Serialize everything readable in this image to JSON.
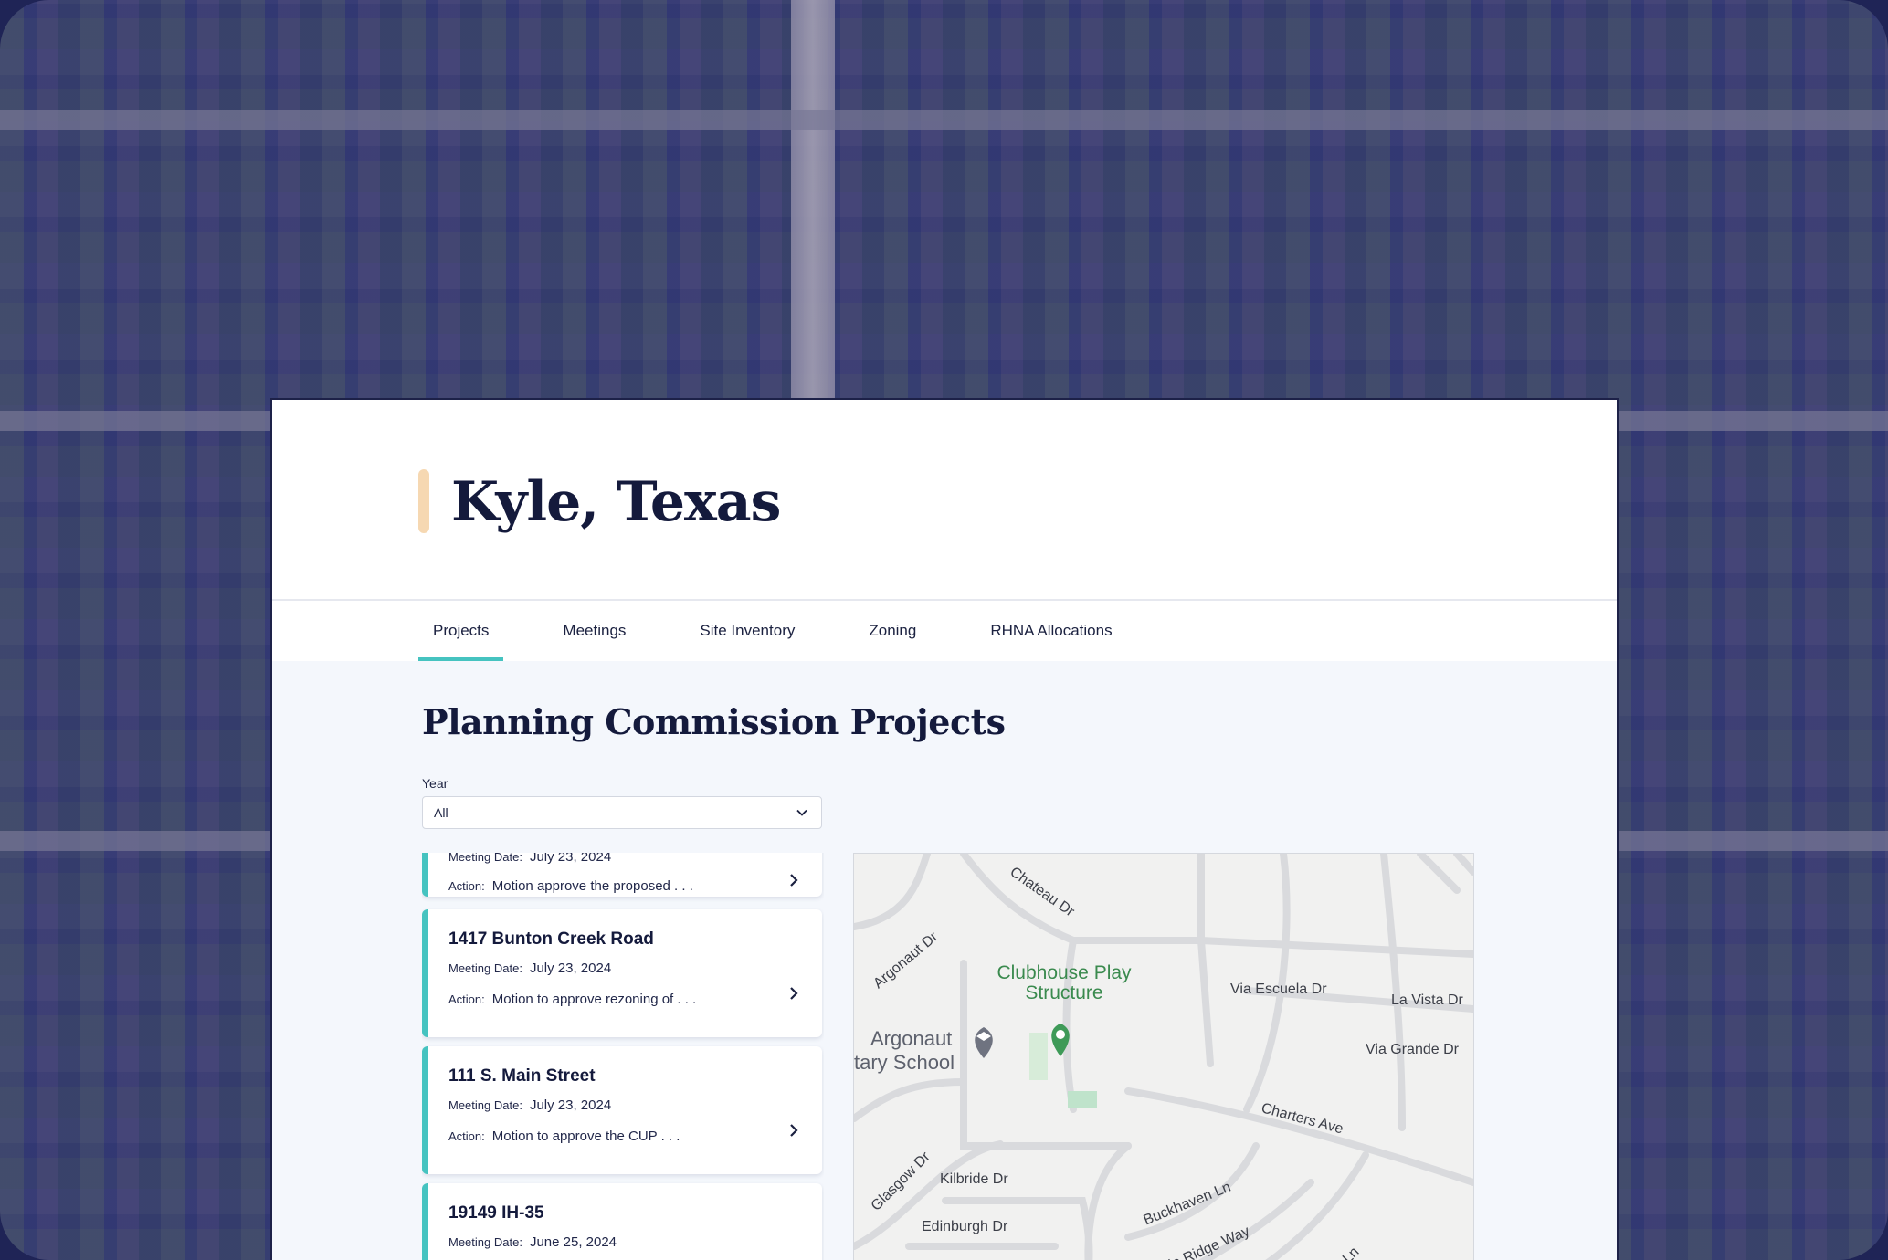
{
  "app": {
    "city_title": "Kyle, Texas",
    "tabs": [
      {
        "label": "Projects",
        "active": true
      },
      {
        "label": "Meetings",
        "active": false
      },
      {
        "label": "Site Inventory",
        "active": false
      },
      {
        "label": "Zoning",
        "active": false
      },
      {
        "label": "RHNA Allocations",
        "active": false
      }
    ]
  },
  "main": {
    "page_title": "Planning Commission Projects",
    "year_filter": {
      "label": "Year",
      "value": "All"
    },
    "projects": [
      {
        "title": "",
        "meeting_label": "Meeting Date:",
        "meeting_date": "July 23, 2024",
        "action_label": "Action:",
        "action": "Motion approve the proposed . . ."
      },
      {
        "title": "1417 Bunton Creek Road",
        "meeting_label": "Meeting Date:",
        "meeting_date": "July 23, 2024",
        "action_label": "Action:",
        "action": "Motion to approve rezoning of . . ."
      },
      {
        "title": "111 S. Main Street",
        "meeting_label": "Meeting Date:",
        "meeting_date": "July 23, 2024",
        "action_label": "Action:",
        "action": "Motion to approve the CUP . . ."
      },
      {
        "title": "19149 IH-35",
        "meeting_label": "Meeting Date:",
        "meeting_date": "June 25, 2024",
        "action_label": "Action:",
        "action": ""
      }
    ]
  },
  "map": {
    "streets": [
      "Chateau Dr",
      "Argonaut Dr",
      "Via Escuela Dr",
      "La Vista Dr",
      "Via Grande Dr",
      "Charters Ave",
      "Glasgow Dr",
      "Kilbride Dr",
      "Buckhaven Ln",
      "Edinburgh Dr",
      "Bonnie Ridge Way",
      "Mark Ln"
    ],
    "poi_park": "Clubhouse Play Structure",
    "poi_school": "Argonaut Elementary School",
    "poi_school_visible_line1": "Argonaut",
    "poi_school_visible_line2": "tary School"
  },
  "colors": {
    "accent": "#45c3c0",
    "title": "#141a3c",
    "highlight_bar": "#f6d8b2",
    "background_tint": "#2c3078"
  }
}
